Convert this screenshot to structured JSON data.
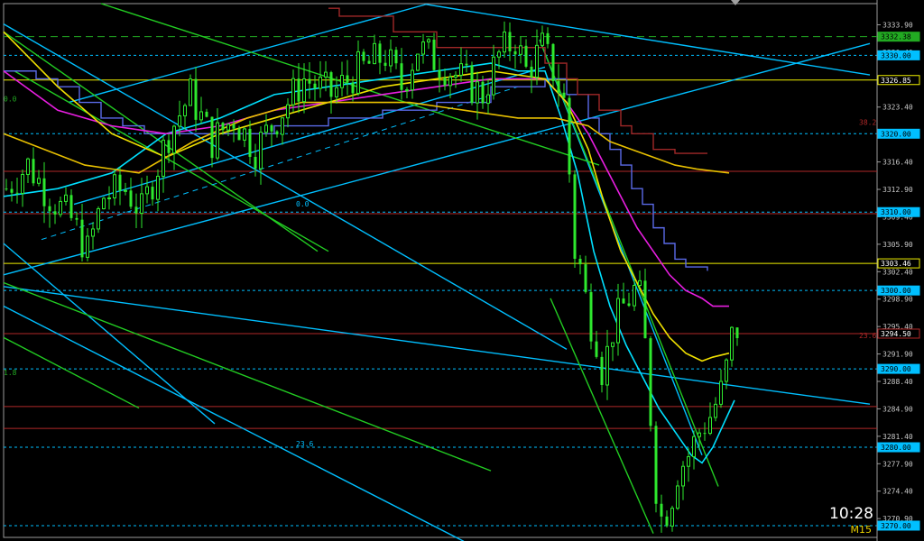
{
  "chart_data": {
    "type": "candlestick",
    "symbol_timeframe": "M15",
    "clock": "10:28",
    "ylim": [
      3268.5,
      3336.6
    ],
    "y_ticks": [
      "3333.90",
      "3330.40",
      "3326.90",
      "3323.40",
      "3319.90",
      "3316.40",
      "3312.90",
      "3309.40",
      "3305.90",
      "3302.40",
      "3298.90",
      "3295.40",
      "3291.90",
      "3288.40",
      "3284.90",
      "3281.40",
      "3277.90",
      "3274.40",
      "3270.90"
    ],
    "price_levels": [
      {
        "value": 3332.38,
        "label": "3332.38",
        "color": "#22aa22",
        "style": "dashed"
      },
      {
        "value": 3330.0,
        "label": "3330.00",
        "color": "#00bfff",
        "style": "dotted"
      },
      {
        "value": 3326.85,
        "label": "3326.85",
        "color": "#f0f000",
        "style": "solid"
      },
      {
        "value": 3320.0,
        "label": "3320.00",
        "color": "#00bfff",
        "style": "dotted"
      },
      {
        "value": 3315.2,
        "label": "",
        "color": "#b02828",
        "style": "solid"
      },
      {
        "value": 3310.0,
        "label": "3310.00",
        "color": "#00bfff",
        "style": "dotted"
      },
      {
        "value": 3309.8,
        "label": "",
        "color": "#b02828",
        "style": "solid"
      },
      {
        "value": 3303.46,
        "label": "3303.46",
        "color": "#f0f000",
        "style": "solid"
      },
      {
        "value": 3300.0,
        "label": "3300.00",
        "color": "#00bfff",
        "style": "dotted"
      },
      {
        "value": 3294.5,
        "label": "3294.50",
        "color": "#b02828",
        "style": "solid"
      },
      {
        "value": 3290.0,
        "label": "3290.00",
        "color": "#00bfff",
        "style": "dotted"
      },
      {
        "value": 3285.2,
        "label": "",
        "color": "#b02828",
        "style": "solid"
      },
      {
        "value": 3282.4,
        "label": "",
        "color": "#b02828",
        "style": "solid"
      },
      {
        "value": 3280.0,
        "label": "3280.00",
        "color": "#00bfff",
        "style": "dotted"
      },
      {
        "value": 3270.0,
        "label": "3270.00",
        "color": "#00bfff",
        "style": "dotted"
      }
    ],
    "fib_labels": [
      {
        "text": "0.0",
        "price": 3323.9,
        "bar": 0,
        "color": "#22aa22"
      },
      {
        "text": "38.2",
        "price": 3320.9,
        "bar": 158,
        "color": "#b02828"
      },
      {
        "text": "0.0",
        "price": 3310.5,
        "bar": 54,
        "color": "#00bfff"
      },
      {
        "text": "23.6",
        "price": 3293.7,
        "bar": 158,
        "color": "#b02828"
      },
      {
        "text": "1.8",
        "price": 3289.0,
        "bar": 0,
        "color": "#22aa22"
      },
      {
        "text": "23.6",
        "price": 3279.9,
        "bar": 54,
        "color": "#00bfff"
      }
    ],
    "close_path": [
      [
        0,
        3313
      ],
      [
        4,
        3316
      ],
      [
        8,
        3312
      ],
      [
        12,
        3309
      ],
      [
        15,
        3305
      ],
      [
        18,
        3312
      ],
      [
        22,
        3313
      ],
      [
        25,
        3310
      ],
      [
        30,
        3320
      ],
      [
        34,
        3325
      ],
      [
        38,
        3319
      ],
      [
        42,
        3322
      ],
      [
        46,
        3318
      ],
      [
        50,
        3322
      ],
      [
        55,
        3327
      ],
      [
        60,
        3325
      ],
      [
        65,
        3328
      ],
      [
        70,
        3330
      ],
      [
        73,
        3326
      ],
      [
        76,
        3331
      ],
      [
        80,
        3329
      ],
      [
        84,
        3327
      ],
      [
        88,
        3325
      ],
      [
        91,
        3330
      ],
      [
        94,
        3332
      ],
      [
        96,
        3328
      ],
      [
        99,
        3331
      ],
      [
        101,
        3328
      ],
      [
        103,
        3324
      ],
      [
        104,
        3315
      ],
      [
        105,
        3305
      ],
      [
        106,
        3303
      ],
      [
        107,
        3299
      ],
      [
        108,
        3296
      ],
      [
        109,
        3294
      ],
      [
        110,
        3290
      ],
      [
        111,
        3292
      ],
      [
        112,
        3295
      ],
      [
        114,
        3298
      ],
      [
        116,
        3300
      ],
      [
        117,
        3299
      ],
      [
        118,
        3293
      ],
      [
        119,
        3284
      ],
      [
        120,
        3275
      ],
      [
        121,
        3271
      ],
      [
        122,
        3272
      ],
      [
        123,
        3274
      ],
      [
        124,
        3277
      ],
      [
        126,
        3279
      ],
      [
        128,
        3282
      ],
      [
        130,
        3284
      ],
      [
        132,
        3287
      ],
      [
        133,
        3290
      ],
      [
        134,
        3294
      ],
      [
        135,
        3295
      ]
    ],
    "moving_averages": [
      {
        "color": "#00e0ff",
        "points": [
          [
            0,
            3312
          ],
          [
            10,
            3313
          ],
          [
            20,
            3315
          ],
          [
            30,
            3320
          ],
          [
            40,
            3322
          ],
          [
            50,
            3325
          ],
          [
            60,
            3326
          ],
          [
            70,
            3327
          ],
          [
            80,
            3328
          ],
          [
            90,
            3329
          ],
          [
            95,
            3328
          ],
          [
            100,
            3328
          ],
          [
            103,
            3322
          ],
          [
            106,
            3315
          ],
          [
            109,
            3305
          ],
          [
            112,
            3298
          ],
          [
            115,
            3293
          ],
          [
            118,
            3289
          ],
          [
            121,
            3285
          ],
          [
            124,
            3282
          ],
          [
            127,
            3279
          ],
          [
            129,
            3278
          ],
          [
            131,
            3280
          ],
          [
            133,
            3283
          ],
          [
            135,
            3286
          ]
        ]
      },
      {
        "color": "#e81ee0",
        "points": [
          [
            0,
            3328
          ],
          [
            10,
            3323
          ],
          [
            20,
            3321
          ],
          [
            30,
            3320
          ],
          [
            40,
            3321
          ],
          [
            50,
            3323
          ],
          [
            60,
            3324
          ],
          [
            70,
            3325
          ],
          [
            80,
            3326
          ],
          [
            90,
            3327
          ],
          [
            100,
            3327
          ],
          [
            104,
            3324
          ],
          [
            108,
            3320
          ],
          [
            111,
            3316
          ],
          [
            114,
            3312
          ],
          [
            117,
            3308
          ],
          [
            120,
            3305
          ],
          [
            123,
            3302
          ],
          [
            126,
            3300
          ],
          [
            129,
            3299
          ],
          [
            131,
            3298
          ],
          [
            134,
            3298
          ]
        ]
      },
      {
        "color": "#f0e000",
        "points": [
          [
            0,
            3333
          ],
          [
            10,
            3326
          ],
          [
            20,
            3320
          ],
          [
            30,
            3317
          ],
          [
            40,
            3320
          ],
          [
            50,
            3322
          ],
          [
            60,
            3324
          ],
          [
            70,
            3326
          ],
          [
            80,
            3327
          ],
          [
            90,
            3328
          ],
          [
            100,
            3327
          ],
          [
            104,
            3324
          ],
          [
            108,
            3318
          ],
          [
            111,
            3311
          ],
          [
            114,
            3305
          ],
          [
            117,
            3301
          ],
          [
            120,
            3297
          ],
          [
            123,
            3294
          ],
          [
            126,
            3292
          ],
          [
            129,
            3291
          ],
          [
            131,
            3291.5
          ],
          [
            134,
            3292
          ]
        ]
      },
      {
        "color": "#e8c000",
        "points": [
          [
            0,
            3320
          ],
          [
            15,
            3316
          ],
          [
            25,
            3315
          ],
          [
            35,
            3319
          ],
          [
            45,
            3322
          ],
          [
            55,
            3324
          ],
          [
            65,
            3324
          ],
          [
            75,
            3324
          ],
          [
            85,
            3323
          ],
          [
            95,
            3322
          ],
          [
            102,
            3322
          ],
          [
            108,
            3321
          ],
          [
            112,
            3319
          ],
          [
            116,
            3318
          ],
          [
            120,
            3317
          ],
          [
            124,
            3316
          ],
          [
            128,
            3315.5
          ],
          [
            134,
            3315
          ]
        ]
      }
    ],
    "step_lines": [
      {
        "color": "#5a6ae8",
        "points": [
          [
            0,
            3328
          ],
          [
            6,
            3327
          ],
          [
            10,
            3326
          ],
          [
            14,
            3324
          ],
          [
            18,
            3322
          ],
          [
            22,
            3321
          ],
          [
            26,
            3320
          ],
          [
            30,
            3320
          ],
          [
            40,
            3320
          ],
          [
            50,
            3321
          ],
          [
            60,
            3322
          ],
          [
            70,
            3323
          ],
          [
            80,
            3324
          ],
          [
            90,
            3326
          ],
          [
            100,
            3327
          ],
          [
            104,
            3325
          ],
          [
            108,
            3322
          ],
          [
            110,
            3320
          ],
          [
            112,
            3318
          ],
          [
            114,
            3316
          ],
          [
            116,
            3313
          ],
          [
            118,
            3311
          ],
          [
            120,
            3308
          ],
          [
            122,
            3306
          ],
          [
            124,
            3304
          ],
          [
            126,
            3303
          ],
          [
            130,
            3302.5
          ]
        ]
      },
      {
        "color": "#a02828",
        "points": [
          [
            60,
            3336
          ],
          [
            62,
            3335
          ],
          [
            70,
            3335
          ],
          [
            72,
            3333
          ],
          [
            78,
            3333
          ],
          [
            80,
            3331
          ],
          [
            90,
            3331
          ],
          [
            96,
            3331
          ],
          [
            100,
            3329
          ],
          [
            104,
            3327
          ],
          [
            106,
            3325
          ],
          [
            110,
            3323
          ],
          [
            114,
            3321
          ],
          [
            116,
            3320
          ],
          [
            118,
            3320
          ],
          [
            120,
            3318
          ],
          [
            124,
            3317.5
          ],
          [
            130,
            3317.5
          ]
        ]
      }
    ],
    "trend_lines": [
      {
        "color": "#00bfff",
        "from": [
          0,
          3302
        ],
        "to": [
          160,
          3331.5
        ]
      },
      {
        "color": "#00bfff",
        "from": [
          12,
          3324
        ],
        "to": [
          78,
          3336.5
        ]
      },
      {
        "color": "#00bfff",
        "from": [
          78,
          3336.5
        ],
        "to": [
          160,
          3327.5
        ]
      },
      {
        "color": "#00bfff",
        "from": [
          13,
          3311
        ],
        "to": [
          100,
          3328.5
        ]
      },
      {
        "color": "#00bfff",
        "from": [
          0,
          3300.5
        ],
        "to": [
          160,
          3285.5
        ]
      },
      {
        "color": "#00bfff",
        "from": [
          0,
          3334
        ],
        "to": [
          104,
          3292.5
        ]
      },
      {
        "color": "#00bfff",
        "from": [
          0,
          3306
        ],
        "to": [
          39,
          3283
        ]
      },
      {
        "color": "#00bfff",
        "from": [
          0,
          3298
        ],
        "to": [
          85,
          3268
        ]
      },
      {
        "color": "#00bfff",
        "from": [
          99,
          3332
        ],
        "to": [
          129,
          3279
        ]
      },
      {
        "color": "#22cc22",
        "from": [
          0,
          3333
        ],
        "to": [
          58,
          3305
        ]
      },
      {
        "color": "#22cc22",
        "from": [
          18,
          3336.6
        ],
        "to": [
          110,
          3316
        ]
      },
      {
        "color": "#22cc22",
        "from": [
          0,
          3301
        ],
        "to": [
          90,
          3277
        ]
      },
      {
        "color": "#22cc22",
        "from": [
          0,
          3294
        ],
        "to": [
          25,
          3285
        ]
      },
      {
        "color": "#22cc22",
        "from": [
          99,
          3332
        ],
        "to": [
          132,
          3275
        ]
      },
      {
        "color": "#22cc22",
        "from": [
          101,
          3299
        ],
        "to": [
          120,
          3269
        ]
      },
      {
        "color": "#22cc22",
        "from": [
          2,
          3328
        ],
        "to": [
          60,
          3305
        ]
      }
    ]
  }
}
